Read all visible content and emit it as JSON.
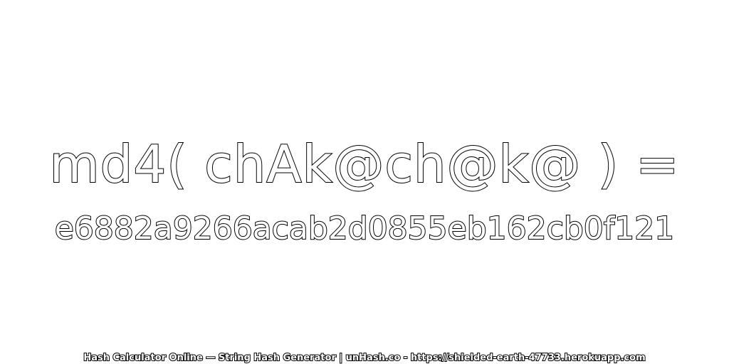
{
  "expression": "md4( chAk@ch@k@ ) =",
  "hash": "e6882a9266acab2d0855eb162cb0f121",
  "footer": "Hash Calculator Online — String Hash Generator | unHash.co - https://shielded-earth-47733.herokuapp.com",
  "colors": {
    "background": "#ffffff",
    "text_fill": "#ffffff",
    "text_outline": "#000000"
  }
}
